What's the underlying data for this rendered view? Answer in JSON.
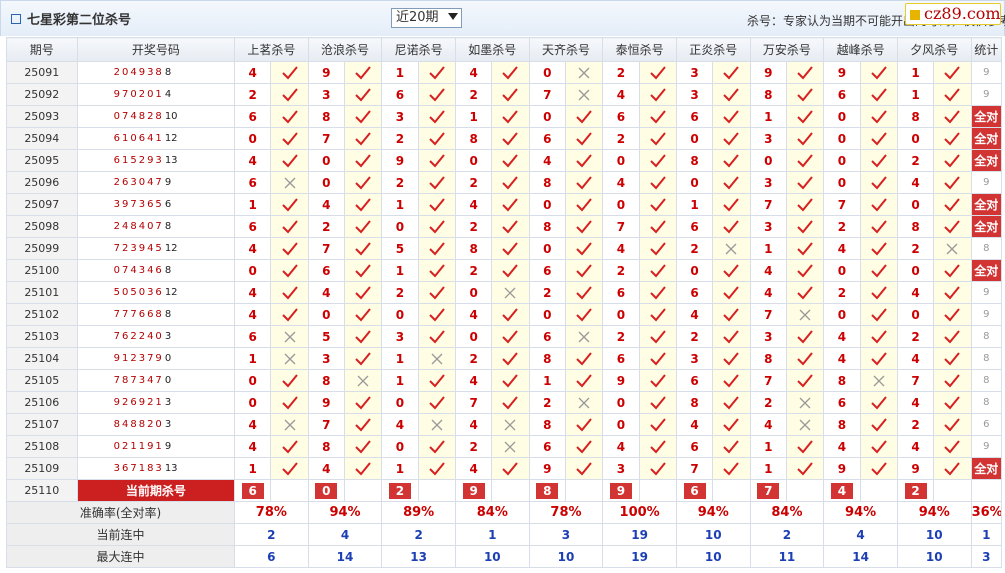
{
  "header": {
    "title": "七星彩第二位杀号",
    "period_select": "近20期",
    "notice": "杀号：专家认为当期不可能开出的号码，仅供参考",
    "logo": "cz89.com"
  },
  "columns": {
    "period": "期号",
    "draw": "开奖号码",
    "experts": [
      "上茗杀号",
      "沧浪杀号",
      "尼诺杀号",
      "如墨杀号",
      "天齐杀号",
      "泰恒杀号",
      "正炎杀号",
      "万安杀号",
      "越峰杀号",
      "夕风杀号"
    ],
    "stat": "统计"
  },
  "rows": [
    {
      "period": "25091",
      "num": "204938",
      "tail": "8",
      "k": [
        4,
        9,
        1,
        4,
        0,
        2,
        3,
        9,
        9,
        1
      ],
      "h": [
        1,
        1,
        1,
        1,
        0,
        1,
        1,
        1,
        1,
        1
      ],
      "tot": "9"
    },
    {
      "period": "25092",
      "num": "970201",
      "tail": "4",
      "k": [
        2,
        3,
        6,
        2,
        7,
        4,
        3,
        8,
        6,
        1
      ],
      "h": [
        1,
        1,
        1,
        1,
        0,
        1,
        1,
        1,
        1,
        1
      ],
      "tot": "9"
    },
    {
      "period": "25093",
      "num": "074828",
      "tail": "10",
      "k": [
        6,
        8,
        3,
        1,
        0,
        6,
        6,
        1,
        0,
        8
      ],
      "h": [
        1,
        1,
        1,
        1,
        1,
        1,
        1,
        1,
        1,
        1
      ],
      "tot": "全对"
    },
    {
      "period": "25094",
      "num": "610641",
      "tail": "12",
      "k": [
        0,
        7,
        2,
        8,
        6,
        2,
        0,
        3,
        0,
        0
      ],
      "h": [
        1,
        1,
        1,
        1,
        1,
        1,
        1,
        1,
        1,
        1
      ],
      "tot": "全对"
    },
    {
      "period": "25095",
      "num": "615293",
      "tail": "13",
      "k": [
        4,
        0,
        9,
        0,
        4,
        0,
        8,
        0,
        0,
        2
      ],
      "h": [
        1,
        1,
        1,
        1,
        1,
        1,
        1,
        1,
        1,
        1
      ],
      "tot": "全对"
    },
    {
      "period": "25096",
      "num": "263047",
      "tail": "9",
      "k": [
        6,
        0,
        2,
        2,
        8,
        4,
        0,
        3,
        0,
        4
      ],
      "h": [
        0,
        1,
        1,
        1,
        1,
        1,
        1,
        1,
        1,
        1
      ],
      "tot": "9"
    },
    {
      "period": "25097",
      "num": "397365",
      "tail": "6",
      "k": [
        1,
        4,
        1,
        4,
        0,
        0,
        1,
        7,
        7,
        0
      ],
      "h": [
        1,
        1,
        1,
        1,
        1,
        1,
        1,
        1,
        1,
        1
      ],
      "tot": "全对"
    },
    {
      "period": "25098",
      "num": "248407",
      "tail": "8",
      "k": [
        6,
        2,
        0,
        2,
        8,
        7,
        6,
        3,
        2,
        8
      ],
      "h": [
        1,
        1,
        1,
        1,
        1,
        1,
        1,
        1,
        1,
        1
      ],
      "tot": "全对"
    },
    {
      "period": "25099",
      "num": "723945",
      "tail": "12",
      "k": [
        4,
        7,
        5,
        8,
        0,
        4,
        2,
        1,
        4,
        2
      ],
      "h": [
        1,
        1,
        1,
        1,
        1,
        1,
        0,
        1,
        1,
        0
      ],
      "tot": "8"
    },
    {
      "period": "25100",
      "num": "074346",
      "tail": "8",
      "k": [
        0,
        6,
        1,
        2,
        6,
        2,
        0,
        4,
        0,
        0
      ],
      "h": [
        1,
        1,
        1,
        1,
        1,
        1,
        1,
        1,
        1,
        1
      ],
      "tot": "全对"
    },
    {
      "period": "25101",
      "num": "505036",
      "tail": "12",
      "k": [
        4,
        4,
        2,
        0,
        2,
        6,
        6,
        4,
        2,
        4
      ],
      "h": [
        1,
        1,
        1,
        0,
        1,
        1,
        1,
        1,
        1,
        1
      ],
      "tot": "9"
    },
    {
      "period": "25102",
      "num": "777668",
      "tail": "8",
      "k": [
        4,
        0,
        0,
        4,
        0,
        0,
        4,
        7,
        0,
        0
      ],
      "h": [
        1,
        1,
        1,
        1,
        1,
        1,
        1,
        0,
        1,
        1
      ],
      "tot": "9"
    },
    {
      "period": "25103",
      "num": "762240",
      "tail": "3",
      "k": [
        6,
        5,
        3,
        0,
        6,
        2,
        2,
        3,
        4,
        2
      ],
      "h": [
        0,
        1,
        1,
        1,
        0,
        1,
        1,
        1,
        1,
        1
      ],
      "tot": "8"
    },
    {
      "period": "25104",
      "num": "912379",
      "tail": "0",
      "k": [
        1,
        3,
        1,
        2,
        8,
        6,
        3,
        8,
        4,
        4
      ],
      "h": [
        0,
        1,
        0,
        1,
        1,
        1,
        1,
        1,
        1,
        1
      ],
      "tot": "8"
    },
    {
      "period": "25105",
      "num": "787347",
      "tail": "0",
      "k": [
        0,
        8,
        1,
        4,
        1,
        9,
        6,
        7,
        8,
        7
      ],
      "h": [
        1,
        0,
        1,
        1,
        1,
        1,
        1,
        1,
        0,
        1
      ],
      "tot": "8"
    },
    {
      "period": "25106",
      "num": "926921",
      "tail": "3",
      "k": [
        0,
        9,
        0,
        7,
        2,
        0,
        8,
        2,
        6,
        4
      ],
      "h": [
        1,
        1,
        1,
        1,
        0,
        1,
        1,
        0,
        1,
        1
      ],
      "tot": "8"
    },
    {
      "period": "25107",
      "num": "848820",
      "tail": "3",
      "k": [
        4,
        7,
        4,
        4,
        8,
        0,
        4,
        4,
        8,
        2
      ],
      "h": [
        0,
        1,
        0,
        0,
        1,
        1,
        1,
        0,
        1,
        1
      ],
      "tot": "6"
    },
    {
      "period": "25108",
      "num": "021191",
      "tail": "9",
      "k": [
        4,
        8,
        0,
        2,
        6,
        4,
        6,
        1,
        4,
        4
      ],
      "h": [
        1,
        1,
        1,
        0,
        1,
        1,
        1,
        1,
        1,
        1
      ],
      "tot": "9"
    },
    {
      "period": "25109",
      "num": "367183",
      "tail": "13",
      "k": [
        1,
        4,
        1,
        4,
        9,
        3,
        7,
        1,
        9,
        9
      ],
      "h": [
        1,
        1,
        1,
        1,
        1,
        1,
        1,
        1,
        1,
        1
      ],
      "tot": "全对"
    }
  ],
  "current": {
    "label": "25110",
    "title": "当前期杀号",
    "values": [
      "6",
      "0",
      "2",
      "9",
      "8",
      "9",
      "6",
      "7",
      "4",
      "2"
    ]
  },
  "stats": [
    {
      "label": "准确率(全对率)",
      "values": [
        "78%",
        "94%",
        "89%",
        "84%",
        "78%",
        "100%",
        "94%",
        "84%",
        "94%",
        "94%"
      ],
      "total": "36%"
    },
    {
      "label": "当前连中",
      "values": [
        "2",
        "4",
        "2",
        "1",
        "3",
        "19",
        "10",
        "2",
        "4",
        "10"
      ],
      "total": "1"
    },
    {
      "label": "最大连中",
      "values": [
        "6",
        "14",
        "13",
        "10",
        "10",
        "19",
        "10",
        "11",
        "14",
        "10"
      ],
      "total": "3"
    }
  ],
  "colors": {
    "hit": "#d82020",
    "miss": "#999999",
    "accent": "#cc0000"
  },
  "icons": {
    "hit": "check-icon",
    "miss": "cross-icon"
  }
}
